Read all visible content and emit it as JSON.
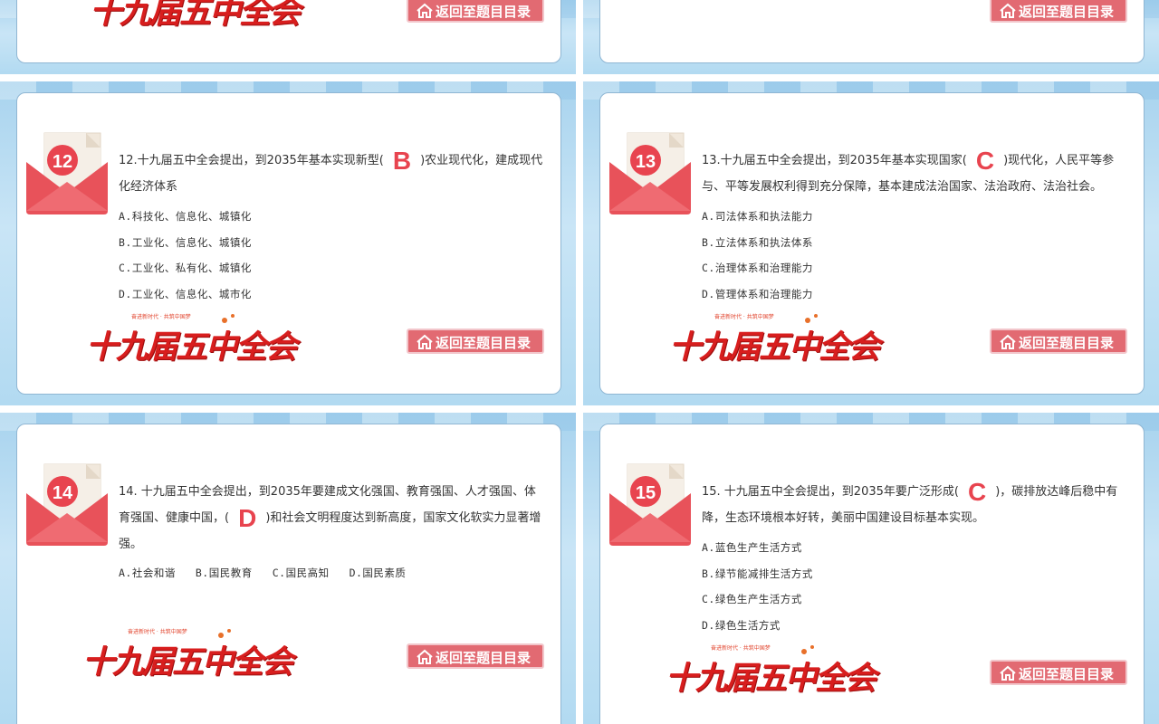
{
  "back_button_label": "返回至题目目录",
  "logo": {
    "brand": "十九届五中全会",
    "slogan": "奋进新时代 · 共筑中国梦"
  },
  "colors": {
    "accent_red": "#e8444f",
    "button_pink": "#e26a72",
    "brand_red": "#d81e1e",
    "background_blue": "#a8d3ee"
  },
  "icons": {
    "envelope": "envelope-icon",
    "home": "home-icon"
  },
  "questions": [
    {
      "number": "12",
      "text_before": "12.十九届五中全会提出，到2035年基本实现新型(",
      "answer": "B",
      "text_after": ")农业现代化，建成现代化经济体系",
      "options": [
        "A.科技化、信息化、城镇化",
        "B.工业化、信息化、城镇化",
        "C.工业化、私有化、城镇化",
        "D.工业化、信息化、城市化"
      ]
    },
    {
      "number": "13",
      "text_before": "13.十九届五中全会提出，到2035年基本实现国家(",
      "answer": "C",
      "text_after": ")现代化，人民平等参与、平等发展权利得到充分保障，基本建成法治国家、法治政府、法治社会。",
      "options": [
        "A.司法体系和执法能力",
        "B.立法体系和执法体系",
        "C.治理体系和治理能力",
        "D.管理体系和治理能力"
      ]
    },
    {
      "number": "14",
      "text_before": "14. 十九届五中全会提出，到2035年要建成文化强国、教育强国、人才强国、体育强国、健康中国，(",
      "answer": "D",
      "text_after": ")和社会文明程度达到新高度，国家文化软实力显著增强。",
      "options": [
        "A.社会和谐",
        "B.国民教育",
        "C.国民高知",
        "D.国民素质"
      ]
    },
    {
      "number": "15",
      "text_before": "15. 十九届五中全会提出，到2035年要广泛形成(",
      "answer": "C",
      "text_after": ")，碳排放达峰后稳中有降，生态环境根本好转，美丽中国建设目标基本实现。",
      "options": [
        "A.蓝色生产生活方式",
        "B.绿节能减排生活方式",
        "C.绿色生产生活方式",
        "D.绿色生活方式"
      ]
    }
  ]
}
